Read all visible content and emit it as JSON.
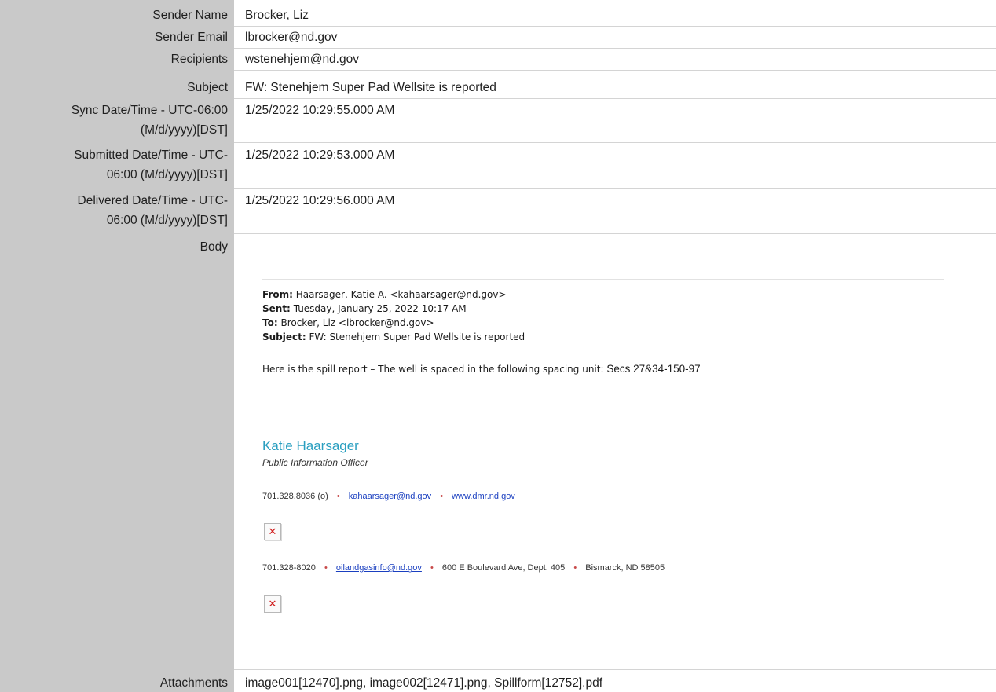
{
  "fields": {
    "sender_name": {
      "label": "Sender Name",
      "value": "Brocker, Liz"
    },
    "sender_email": {
      "label": "Sender Email",
      "value": "lbrocker@nd.gov"
    },
    "recipients": {
      "label": "Recipients",
      "value": "wstenehjem@nd.gov"
    },
    "subject": {
      "label": "Subject",
      "value": "FW: Stenehjem Super Pad Wellsite is reported"
    },
    "sync": {
      "label_1": "Sync Date/Time - UTC-06:00",
      "label_2": "(M/d/yyyy)[DST]",
      "value": "1/25/2022 10:29:55.000 AM"
    },
    "submitted": {
      "label_1": "Submitted Date/Time - UTC-",
      "label_2": "06:00 (M/d/yyyy)[DST]",
      "value": "1/25/2022 10:29:53.000 AM"
    },
    "delivered": {
      "label_1": "Delivered Date/Time - UTC-",
      "label_2": "06:00 (M/d/yyyy)[DST]",
      "value": "1/25/2022 10:29:56.000 AM"
    },
    "body": {
      "label": "Body"
    },
    "attachments": {
      "label": "Attachments",
      "value": "image001[12470].png, image002[12471].png, Spillform[12752].pdf"
    }
  },
  "email_body": {
    "from_label": "From:",
    "from_value": "Haarsager, Katie A. <kahaarsager@nd.gov>",
    "sent_label": "Sent:",
    "sent_value": "Tuesday, January 25, 2022 10:17 AM",
    "to_label": "To:",
    "to_value": "Brocker, Liz <lbrocker@nd.gov>",
    "subject_label": "Subject:",
    "subject_value": "FW: Stenehjem Super Pad Wellsite is reported",
    "intro": "Here is the spill report – The well is spaced in the following spacing unit:",
    "spacing_unit": "Secs 27&34-150-97",
    "sig_name": "Katie Haarsager",
    "sig_title": "Public Information Officer",
    "phone_1": "701.328.8036 (o)",
    "email_1": "kahaarsager@nd.gov",
    "web_1": "www.dmr.nd.gov",
    "phone_2": "701.328-8020",
    "email_2": "oilandgasinfo@nd.gov",
    "address": "600 E Boulevard Ave, Dept. 405",
    "city": "Bismarck, ND  58505",
    "separator": "•",
    "broken_image_glyph": "✕"
  },
  "icons": {
    "broken_image": "broken-image-icon"
  },
  "colors": {
    "label_bg": "#c9c9c9",
    "signature_name": "#2a9fc0",
    "link": "#1a3fc0",
    "bullet": "#c84a4a",
    "broken_x": "#d01c1c"
  }
}
